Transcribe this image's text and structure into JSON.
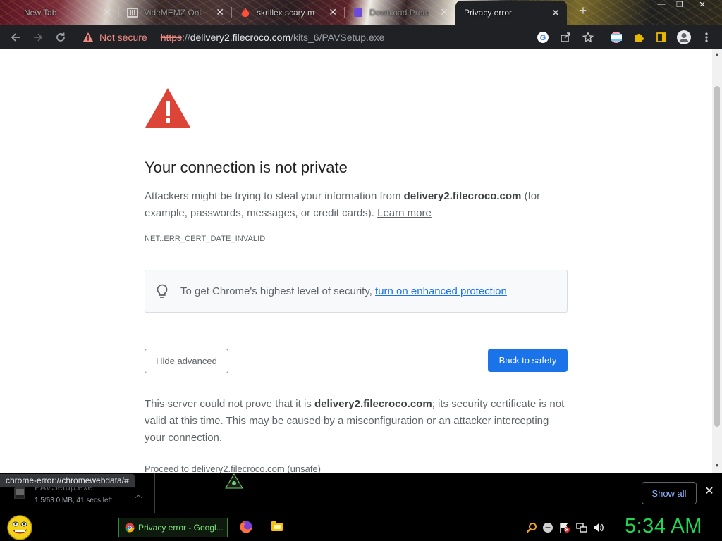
{
  "tabs": [
    {
      "title": "New Tab"
    },
    {
      "title": "VideMEMZ Onl"
    },
    {
      "title": "skrillex scary m"
    },
    {
      "title": "Download Prote"
    },
    {
      "title": "Privacy error"
    }
  ],
  "toolbar": {
    "not_secure": "Not secure",
    "url_scheme": "https",
    "url_sep": "://",
    "url_host": "delivery2.filecroco.com",
    "url_path": "/kits_6/PAVSetup.exe"
  },
  "page": {
    "heading": "Your connection is not private",
    "intro_1": "Attackers might be trying to steal your information from ",
    "intro_host": "delivery2.filecroco.com",
    "intro_2": " (for example, passwords, messages, or credit cards). ",
    "learn_more": "Learn more",
    "error_code": "NET::ERR_CERT_DATE_INVALID",
    "tip_text": "To get Chrome's highest level of security, ",
    "tip_link": "turn on enhanced protection",
    "hide_advanced": "Hide advanced",
    "back_to_safety": "Back to safety",
    "detail_1": "This server could not prove that it is ",
    "detail_host": "delivery2.filecroco.com",
    "detail_2": "; its security certificate is not valid at this time. This may be caused by a misconfiguration or an attacker intercepting your connection.",
    "proceed": "Proceed to delivery2.filecroco.com (unsafe)"
  },
  "status_bubble": "chrome-error://chromewebdata/#",
  "download": {
    "filename": "PAVSetup.exe",
    "progress": "1.5/63.0 MB, 41 secs left",
    "show_all": "Show all"
  },
  "taskbar": {
    "active_window": "Privacy error - Googl...",
    "clock": "5:34 AM"
  },
  "colors": {
    "accent": "#1a73e8",
    "warning_red": "#db4437",
    "clock_green": "#1fd655"
  }
}
